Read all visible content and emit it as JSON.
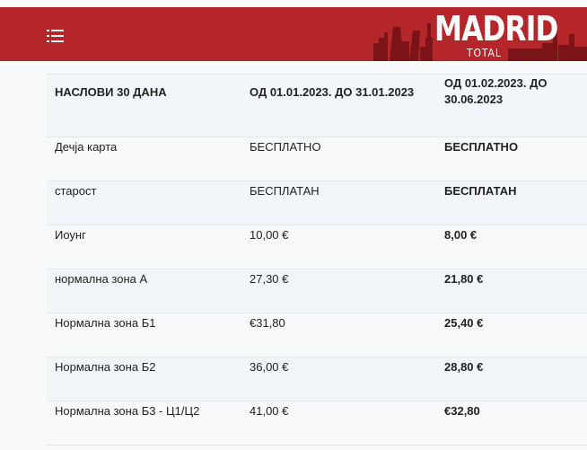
{
  "header": {
    "logo_main": "MADRID",
    "logo_sub": "TOTAL",
    "menu_icon": "hamburger-menu-icon"
  },
  "table": {
    "columns": [
      "НАСЛОВИ 30 ДАНА",
      "ОД 01.01.2023. ДО 31.01.2023",
      "ОД 01.02.2023. ДО 30.06.2023"
    ],
    "rows": [
      [
        "Дечја карта",
        "БЕСПЛАТНО",
        "БЕСПЛАТНО"
      ],
      [
        "старост",
        "БЕСПЛАТАН",
        "БЕСПЛАТАН"
      ],
      [
        "Иоунг",
        "10,00 €",
        "8,00 €"
      ],
      [
        "нормална зона А",
        "27,30 €",
        "21,80 €"
      ],
      [
        "Нормална зона Б1",
        "€31,80",
        "25,40 €"
      ],
      [
        "Нормална зона Б2",
        "36,00 €",
        "28,80 €"
      ],
      [
        "Нормална зона Б3 - Ц1/Ц2",
        "41,00 €",
        "€32,80"
      ]
    ]
  },
  "colors": {
    "header_bg": "#b5262b",
    "skyline": "#7a1418"
  }
}
